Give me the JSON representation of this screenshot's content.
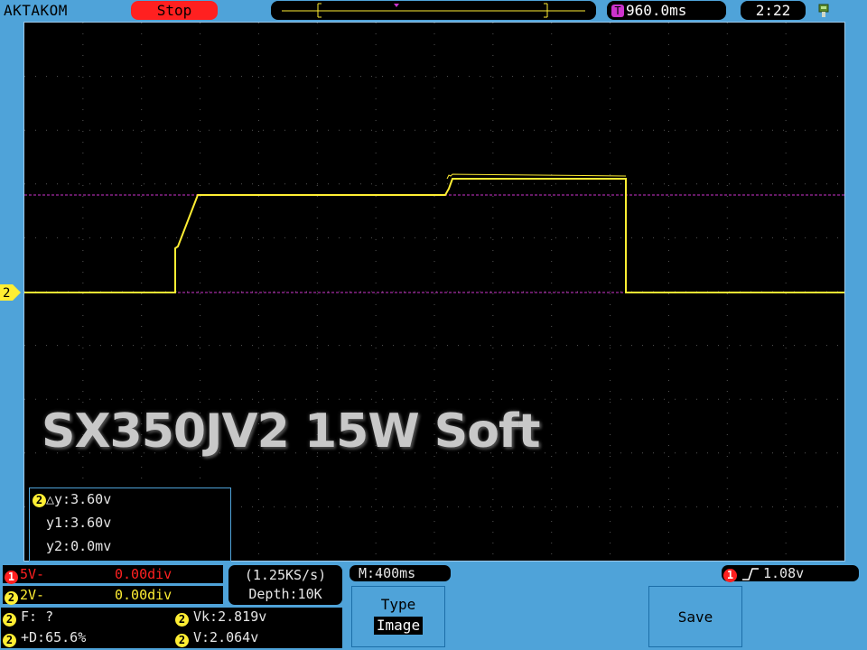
{
  "topbar": {
    "brand": "AKTAKOM",
    "run_status": "Stop",
    "timebase_prefix": "T",
    "time_offset": "960.0ms",
    "clock": "2:22",
    "usb_icon": "usb-icon"
  },
  "screen": {
    "channel_marker": "2",
    "overlay_title": "SX350JV2 15W Soft",
    "trace_color": "#ffee33",
    "cursor_color": "#cc33cc"
  },
  "cursor_readout": {
    "channel": "2",
    "delta": "△y:3.60v",
    "y1": "y1:3.60v",
    "y2": "y2:0.0mv"
  },
  "channels": [
    {
      "num": "1",
      "scale": "5V-",
      "position": "0.00div",
      "color": "#ff2020"
    },
    {
      "num": "2",
      "scale": "2V-",
      "position": "0.00div",
      "color": "#ffee33"
    }
  ],
  "acquisition": {
    "sample_rate": "(1.25KS/s)",
    "depth": "Depth:10K",
    "main_time": "M:400ms"
  },
  "trigger": {
    "channel": "1",
    "edge_icon": "rising-edge-icon",
    "level": "1.08v"
  },
  "measurements": [
    {
      "channel": "2",
      "text": "F:  ?"
    },
    {
      "channel": "2",
      "text": "Vk:2.819v"
    },
    {
      "channel": "2",
      "text": "+D:65.6%"
    },
    {
      "channel": "2",
      "text": "V:2.064v"
    }
  ],
  "softkeys": {
    "type_label": "Type",
    "type_value": "Image",
    "save_label": "Save"
  }
}
